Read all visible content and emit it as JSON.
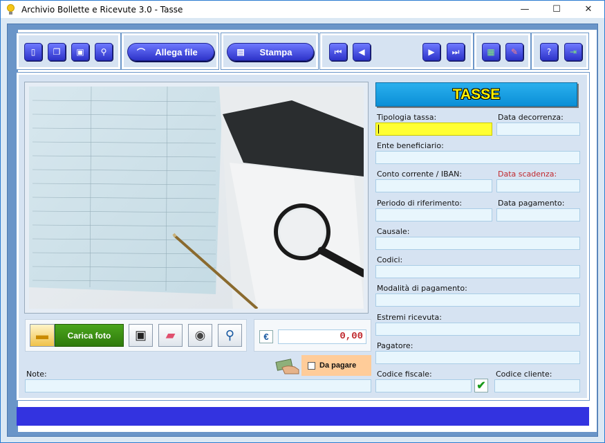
{
  "window": {
    "title": "Archivio Bollette e Ricevute 3.0 - Tasse",
    "minimize": "—",
    "maximize": "☐",
    "close": "✕"
  },
  "toolbar": {
    "attach_label": "Allega file",
    "print_label": "Stampa",
    "icons": [
      "new-record-icon",
      "copy-icon",
      "save-icon",
      "search-icon",
      "paperclip-icon",
      "printer-icon",
      "first-record-icon",
      "previous-record-icon",
      "next-record-icon",
      "last-record-icon",
      "excel-export-icon",
      "settings-icon",
      "help-icon",
      "exit-icon"
    ]
  },
  "header": {
    "title": "TASSE"
  },
  "form": {
    "tipologia_tassa": "Tipologia tassa:",
    "data_decorrenza": "Data decorrenza:",
    "ente_beneficiario": "Ente beneficiario:",
    "conto_corrente": "Conto corrente / IBAN:",
    "data_scadenza": "Data scadenza:",
    "periodo_riferimento": "Periodo di riferimento:",
    "data_pagamento": "Data pagamento:",
    "causale": "Causale:",
    "codici": "Codici:",
    "modalita_pagamento": "Modalità di pagamento:",
    "estremi_ricevuta": "Estremi ricevuta:",
    "pagatore": "Pagatore:",
    "codice_fiscale": "Codice fiscale:",
    "codice_cliente": "Codice cliente:",
    "note": "Note:"
  },
  "photo_bar": {
    "load_photo_label": "Carica foto"
  },
  "amount": {
    "currency": "€",
    "value": "0,00"
  },
  "da_pagare": {
    "label": "Da pagare",
    "checked": false
  },
  "colors": {
    "accent_blue": "#3333e0",
    "header_cyan": "#0a8fd6",
    "title_yellow": "#fff200",
    "required_red": "#c0282d"
  }
}
